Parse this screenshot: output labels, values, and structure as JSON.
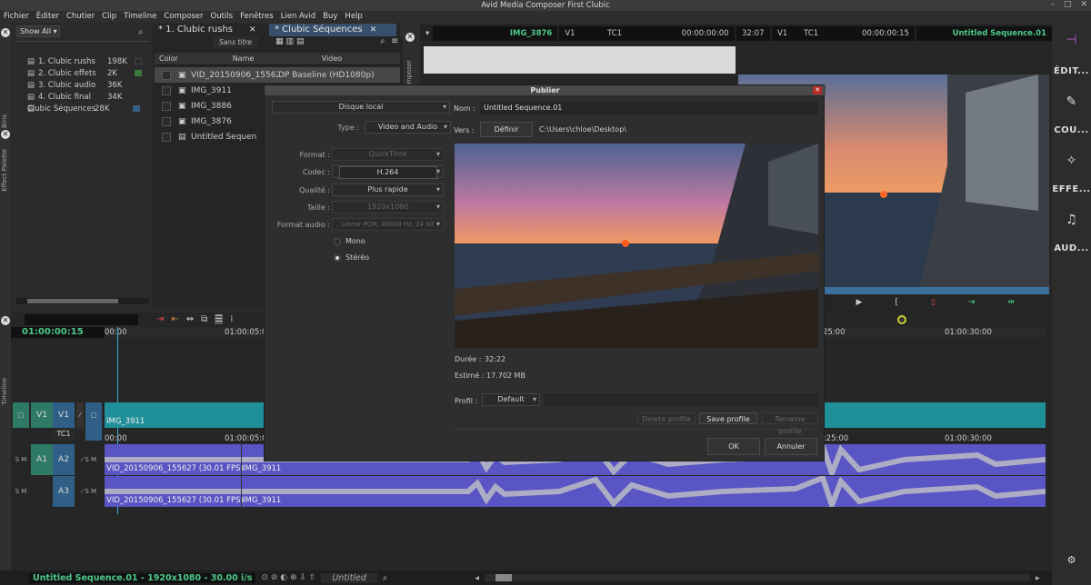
{
  "window": {
    "title": "Avid Media Composer First  Clubic"
  },
  "menu": [
    "Fichier",
    "Éditer",
    "Chutier",
    "Clip",
    "Timeline",
    "Composer",
    "Outils",
    "Fenêtres",
    "Lien Avid",
    "Buy",
    "Help"
  ],
  "side_tabs": {
    "bins": "Bins",
    "effects": "Effect Palette",
    "timeline": "Timeline",
    "composer": "Composer"
  },
  "bins": {
    "show_all": "Show All",
    "items": [
      {
        "name": "1. Clubic rushs",
        "size": "198K",
        "color": "#2a2a2a"
      },
      {
        "name": "2. Clubic effets",
        "size": "2K",
        "color": "#3c7a3c"
      },
      {
        "name": "3. Clubic audio",
        "size": "36K",
        "color": "#2a2a2a"
      },
      {
        "name": "4. Clubic final",
        "size": "34K",
        "color": "#2a2a2a"
      },
      {
        "name": "Clubic Séquences",
        "size": "28K",
        "color": "#3b5e86"
      }
    ]
  },
  "bin_tabs": [
    {
      "label": "* 1. Clubic rushs"
    },
    {
      "label": "* Clubic Séquences"
    }
  ],
  "bin_view": {
    "dropdown": "Sans titre",
    "columns": [
      "Color",
      "Name",
      "Video"
    ]
  },
  "clips": [
    {
      "name": "VID_20150906_155627",
      "video": "DP Baseline (HD1080p)"
    },
    {
      "name": "IMG_3911",
      "video": ""
    },
    {
      "name": "IMG_3886",
      "video": ""
    },
    {
      "name": "IMG_3876",
      "video": ""
    },
    {
      "name": "Untitled Sequen",
      "video": ""
    }
  ],
  "viewer": {
    "source_clip": "IMG_3876",
    "src_track": "V1",
    "src_tc": "TC1",
    "src_time": "00:00:00:00",
    "duration": "32:07",
    "rec_track": "V1",
    "rec_tc": "TC1",
    "rec_time": "00:00:00:15",
    "record_seq": "Untitled Sequence.01"
  },
  "right_panel": [
    "ÉDIT...",
    "COU...",
    "EFFE...",
    "AUD..."
  ],
  "dialog": {
    "title": "Publier",
    "destination": "Disque local",
    "type_label": "Type :",
    "type": "Video and Audio",
    "format_label": "Format :",
    "format": "QuickTime",
    "codec_label": "Codec :",
    "codec": "H.264",
    "quality_label": "Qualité :",
    "quality": "Plus rapide",
    "size_label": "Taille :",
    "size": "1920x1080",
    "audio_label": "Format audio :",
    "audio": "Linear PCM, 48000 Hz, 24 bit",
    "mono": "Mono",
    "stereo": "Stéréo",
    "name_label": "Nom :",
    "name": "Untitled Sequence.01",
    "to_label": "Vers :",
    "define": "Définir",
    "path": "C:\\Users\\chloe\\Desktop\\",
    "duration_label": "Durée :",
    "duration": "32:22",
    "estimate_label": "Estimé :",
    "estimate": "17.702 MB",
    "profile_label": "Profil :",
    "profile": "Default",
    "delete_profile": "Delete profile",
    "save_profile": "Save profile",
    "rename_profile": "Rename profile",
    "ok": "OK",
    "cancel": "Annuler"
  },
  "timeline": {
    "timecode": "01:00:00:15",
    "ruler": [
      "00:00",
      "01:00:05:0",
      "25:00",
      "01:00:30:00"
    ],
    "ruler2": [
      "00:00",
      "01:00:05:0",
      "00:25:00",
      "01:00:30:00"
    ],
    "tracks": {
      "v1_src": "V1",
      "v1": "V1",
      "tc1": "TC1",
      "a1_src": "A1",
      "a2": "A2",
      "a3": "A3"
    },
    "clips": {
      "v1": "IMG_3911",
      "a2_1": "VID_20150906_155627 (30.01 FPS)",
      "a2_2": "IMG_3911",
      "a3_1": "VID_20150906_155627 (30.01 FPS)",
      "a3_2": "IMG_3911"
    }
  },
  "status": {
    "sequence": "Untitled Sequence.01 - 1920x1080 - 30.00 i/s",
    "view": "Untitled"
  },
  "colors": {
    "accent_green": "#4ec98a",
    "video_track": "#1f8f9a",
    "audio_track": "#5a55c4",
    "track_blue": "#2f5e86"
  }
}
